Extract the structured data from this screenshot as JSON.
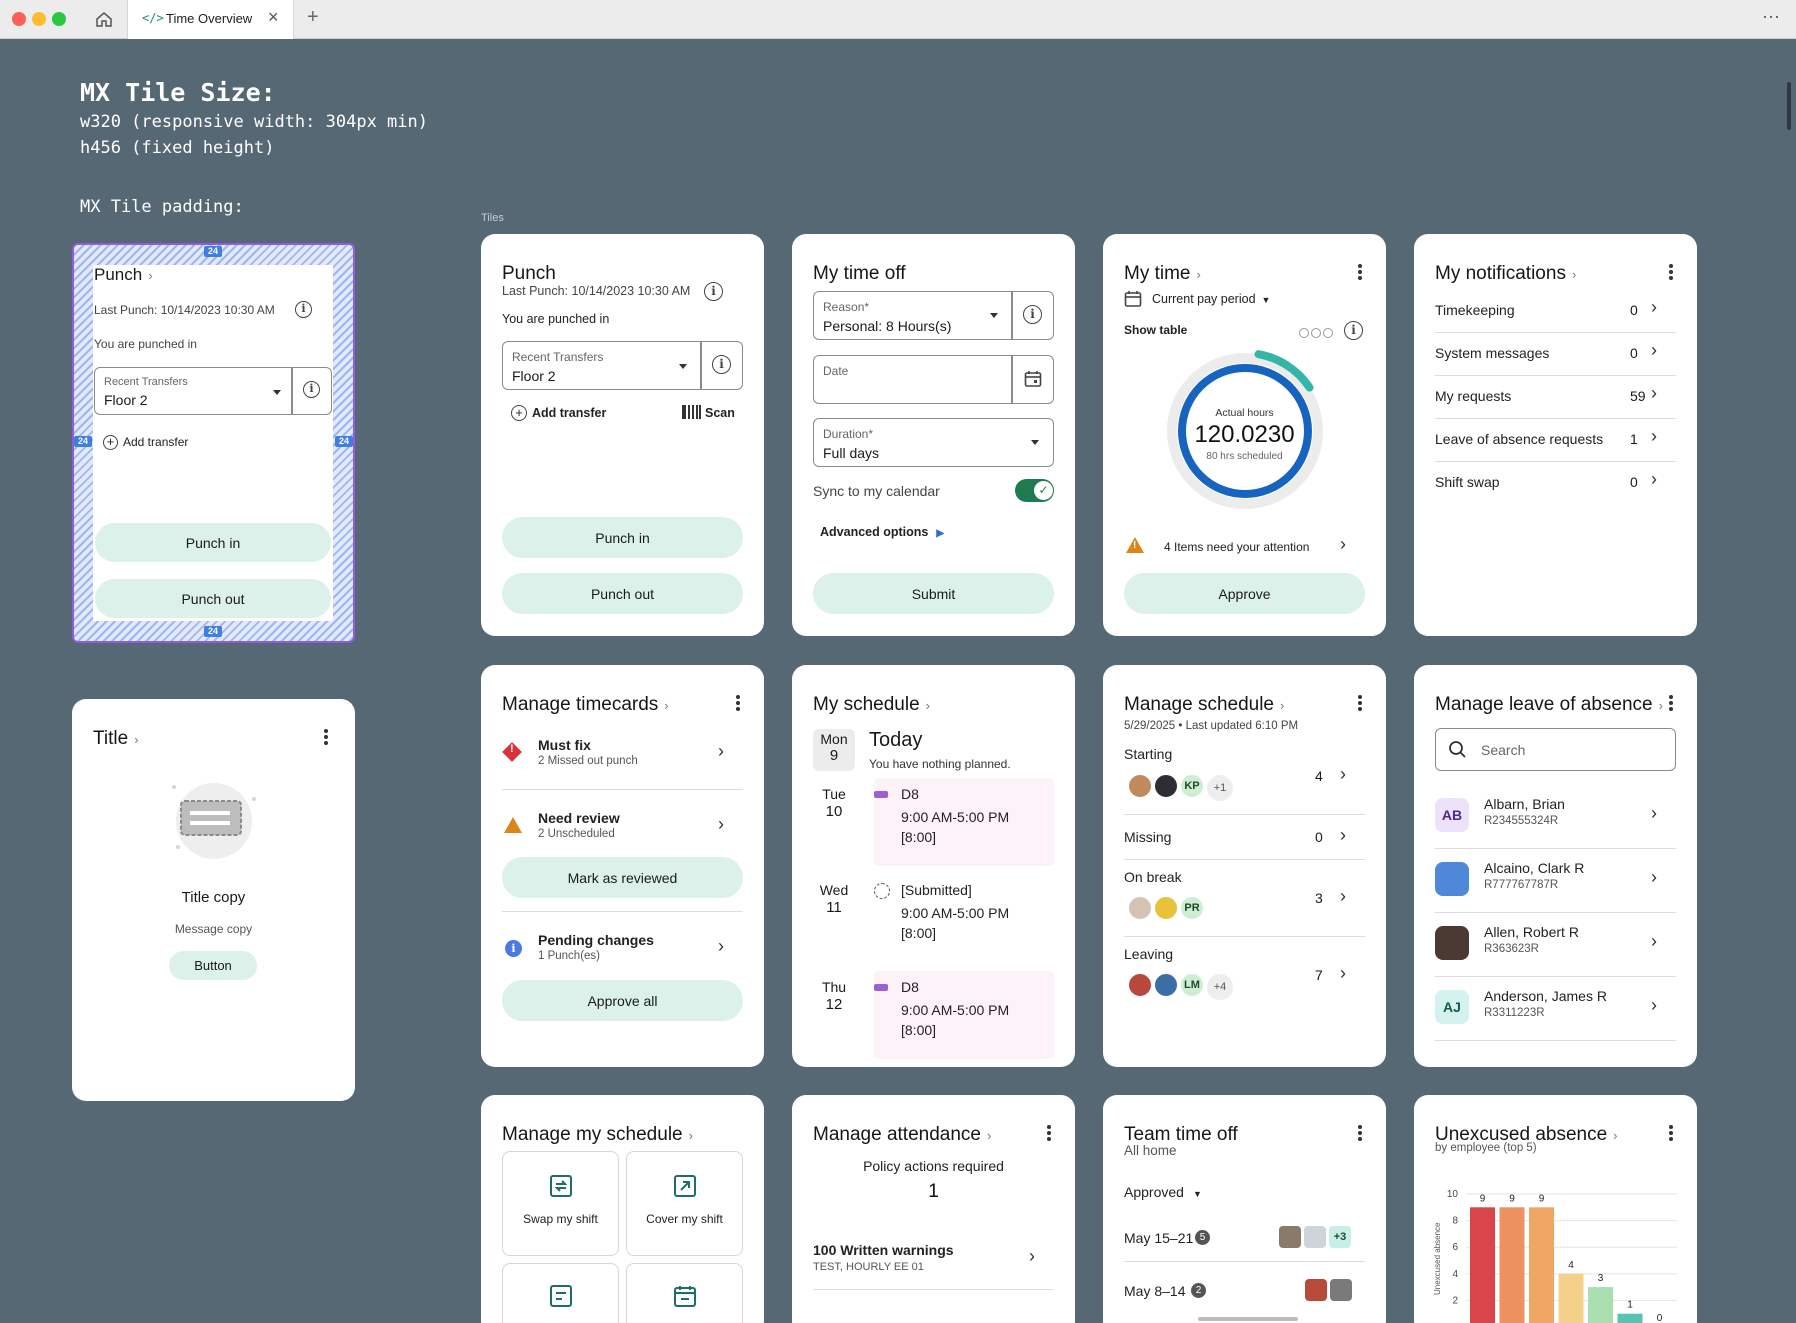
{
  "browser": {
    "tab_title": "Time Overview"
  },
  "spec": {
    "heading": "MX Tile Size:",
    "width_line": "w320 (responsive width: 304px min)",
    "height_line": "h456 (fixed height)",
    "padding_label": "MX Tile padding:",
    "padding_value": "24"
  },
  "section_label": "Tiles",
  "demo_punch": {
    "title": "Punch",
    "last_punch": "Last Punch: 10/14/2023 10:30 AM",
    "status": "You are punched in",
    "field_label": "Recent Transfers",
    "field_value": "Floor 2",
    "add_transfer": "Add transfer",
    "punch_in": "Punch in",
    "punch_out": "Punch out"
  },
  "empty_tile": {
    "title": "Title",
    "title_copy": "Title copy",
    "message_copy": "Message copy",
    "button": "Button"
  },
  "punch": {
    "title": "Punch",
    "last_punch": "Last Punch: 10/14/2023 10:30 AM",
    "status": "You are punched in",
    "field_label": "Recent Transfers",
    "field_value": "Floor 2",
    "add_transfer": "Add transfer",
    "scan": "Scan",
    "punch_in": "Punch in",
    "punch_out": "Punch out"
  },
  "time_off": {
    "title": "My time off",
    "reason_label": "Reason*",
    "reason_value": "Personal: 8 Hours(s)",
    "date_label": "Date",
    "duration_label": "Duration*",
    "duration_value": "Full days",
    "sync_label": "Sync to my calendar",
    "sync_on": true,
    "advanced": "Advanced options",
    "submit": "Submit"
  },
  "my_time": {
    "title": "My time",
    "period": "Current pay period",
    "show_table": "Show table",
    "ring_caption": "Actual hours",
    "ring_value": "120.0230",
    "ring_sub": "80 hrs scheduled",
    "attention": "4 Items need your attention",
    "approve": "Approve"
  },
  "notifications": {
    "title": "My notifications",
    "items": [
      {
        "label": "Timekeeping",
        "count": "0"
      },
      {
        "label": "System messages",
        "count": "0"
      },
      {
        "label": "My requests",
        "count": "59"
      },
      {
        "label": "Leave of absence requests",
        "count": "1"
      },
      {
        "label": "Shift swap",
        "count": "0"
      }
    ]
  },
  "timecards": {
    "title": "Manage timecards",
    "must_fix": "Must fix",
    "must_fix_sub": "2 Missed out punch",
    "need_review": "Need review",
    "need_review_sub": "2 Unscheduled",
    "mark_reviewed": "Mark as reviewed",
    "pending": "Pending changes",
    "pending_sub": "1 Punch(es)",
    "approve_all": "Approve all"
  },
  "my_schedule": {
    "title": "My schedule",
    "today_dow": "Mon",
    "today_num": "9",
    "today_label": "Today",
    "today_sub": "You have nothing planned.",
    "days": [
      {
        "dow": "Tue",
        "num": "10",
        "code": "D8",
        "time": "9:00 AM-5:00 PM",
        "hours": "[8:00]"
      },
      {
        "dow": "Wed",
        "num": "11",
        "code": "[Submitted]",
        "time": "9:00 AM-5:00 PM",
        "hours": "[8:00]"
      },
      {
        "dow": "Thu",
        "num": "12",
        "code": "D8",
        "time": "9:00 AM-5:00 PM",
        "hours": "[8:00]"
      }
    ]
  },
  "manage_schedule": {
    "title": "Manage schedule",
    "subtitle": "5/29/2025 • Last updated 6:10 PM",
    "starting": "Starting",
    "starting_count": "4",
    "starting_initials": "KP",
    "starting_more": "+1",
    "missing": "Missing",
    "missing_count": "0",
    "on_break": "On break",
    "on_break_count": "3",
    "on_break_initials": "PR",
    "leaving": "Leaving",
    "leaving_count": "7",
    "leaving_initials": "LM",
    "leaving_more": "+4"
  },
  "leave": {
    "title": "Manage leave of absence",
    "search_placeholder": "Search",
    "people": [
      {
        "initials": "AB",
        "name": "Albarn, Brian",
        "id": "R234555324R"
      },
      {
        "initials": "",
        "name": "Alcaino, Clark R",
        "id": "R777767787R"
      },
      {
        "initials": "",
        "name": "Allen, Robert R",
        "id": "R363623R"
      },
      {
        "initials": "AJ",
        "name": "Anderson, James R",
        "id": "R3311223R"
      }
    ]
  },
  "manage_my_schedule": {
    "title": "Manage my schedule",
    "swap": "Swap my shift",
    "cover": "Cover my shift"
  },
  "attendance": {
    "title": "Manage attendance",
    "policy": "Policy actions required",
    "policy_count": "1",
    "warning": "100 Written warnings",
    "warning_sub": "TEST, HOURLY EE 01"
  },
  "team_time_off": {
    "title": "Team time off",
    "subtitle": "All home",
    "filter": "Approved",
    "rows": [
      {
        "range": "May 15–21",
        "count": "5",
        "more": "+3"
      },
      {
        "range": "May 8–14",
        "count": "2"
      }
    ]
  },
  "unexcused": {
    "title": "Unexcused absence",
    "subtitle": "by employee (top 5)",
    "ylabel": "Unexcused absence"
  },
  "chart_data": {
    "type": "bar",
    "title": "Unexcused absence",
    "subtitle": "by employee (top 5)",
    "ylabel": "Unexcused absence",
    "ylim": [
      0,
      10
    ],
    "yticks": [
      2,
      4,
      6,
      8,
      10
    ],
    "values": [
      9,
      9,
      9,
      4,
      3,
      1,
      0
    ],
    "colors": [
      "#d8464b",
      "#ec9160",
      "#f0a766",
      "#f5d089",
      "#a9dfb0",
      "#55c5b3",
      "#55c5b3"
    ]
  }
}
